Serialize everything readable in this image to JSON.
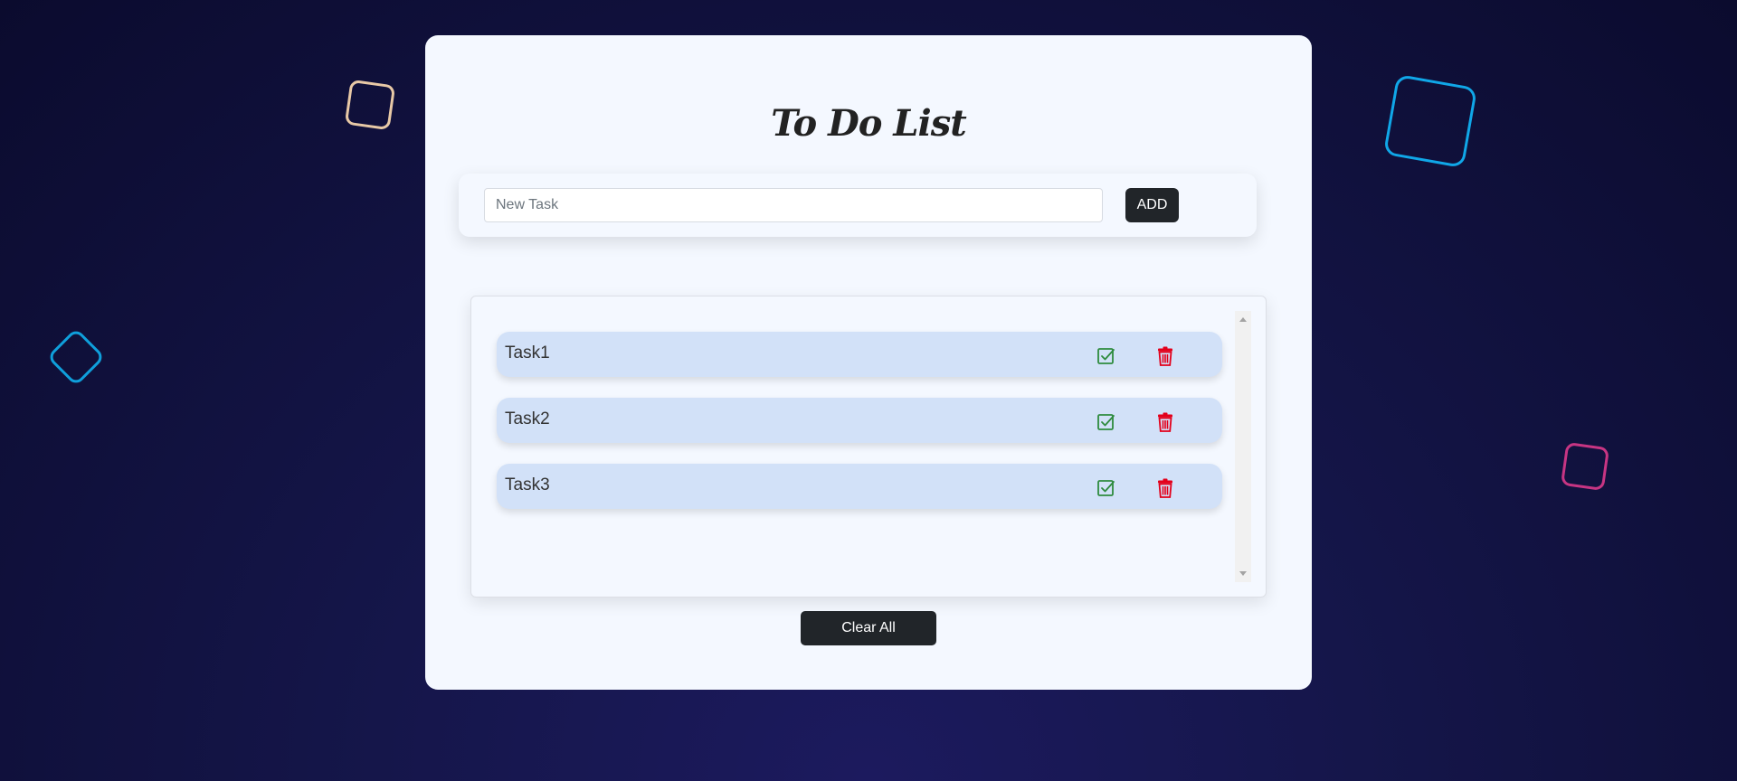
{
  "page": {
    "title": "To Do List"
  },
  "input": {
    "placeholder": "New Task",
    "value": "",
    "add_label": "ADD"
  },
  "tasks": [
    {
      "text": "Task1"
    },
    {
      "text": "Task2"
    },
    {
      "text": "Task3"
    }
  ],
  "actions": {
    "clear_all_label": "Clear All"
  },
  "icons": {
    "complete": "check-square-icon",
    "delete": "trash-icon"
  },
  "colors": {
    "check": "#2e8b3e",
    "delete": "#e3001b",
    "button_dark": "#212529",
    "task_bg": "#d2e1f8"
  }
}
